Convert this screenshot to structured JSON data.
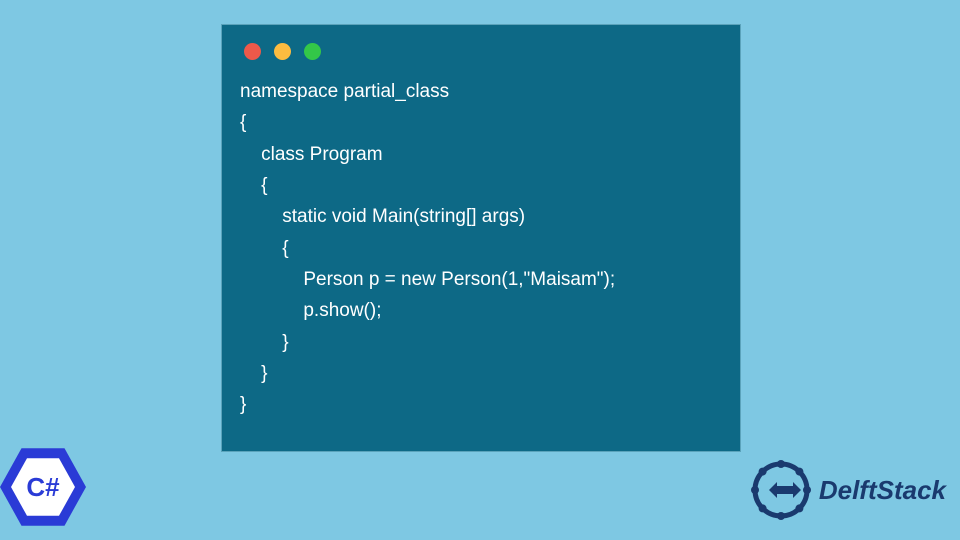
{
  "code": {
    "lines": [
      "namespace partial_class",
      "{",
      "    class Program",
      "    {",
      "        static void Main(string[] args)",
      "        {",
      "            Person p = new Person(1,\"Maisam\");",
      "            p.show();",
      "        }",
      "    }",
      "}"
    ]
  },
  "csharp_label": "C#",
  "delft_label": "DelftStack"
}
